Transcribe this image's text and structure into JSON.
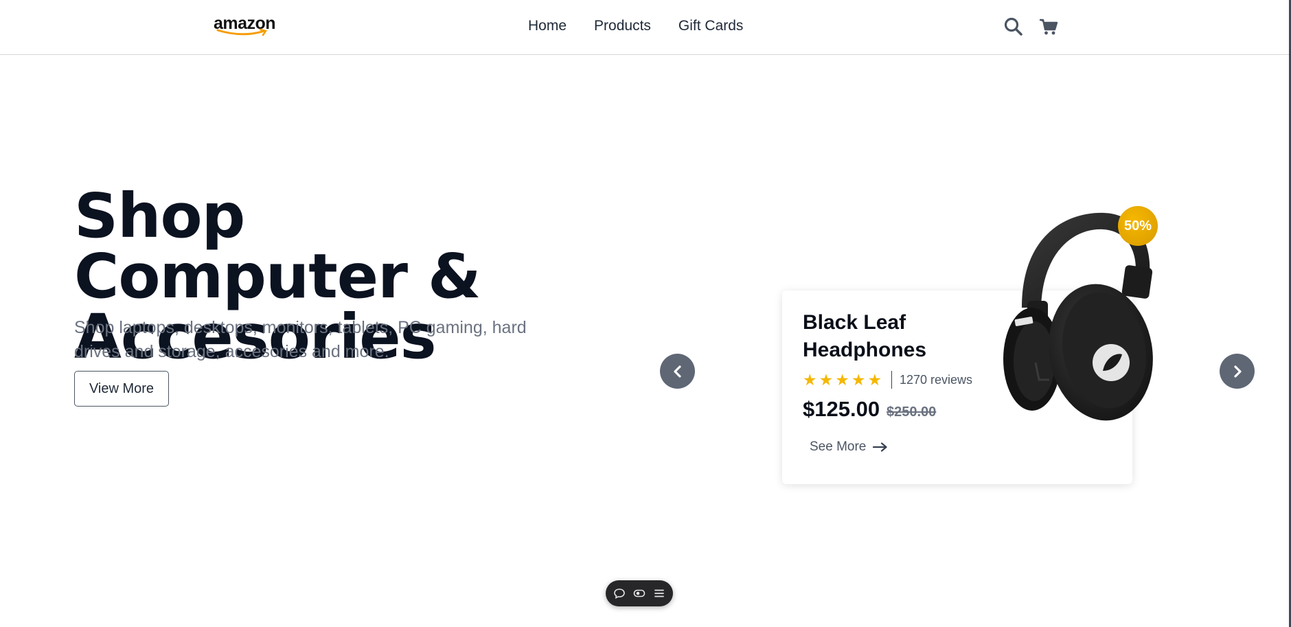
{
  "header": {
    "logo_text": "amazon",
    "nav": [
      "Home",
      "Products",
      "Gift Cards"
    ],
    "icons": [
      "search-icon",
      "cart-icon"
    ]
  },
  "hero": {
    "title": "Shop Computer & Accesories",
    "subtitle": "Shop laptops, desktops, monitors, tablets, PC gaming, hard drives and storage, accesories and more.",
    "button_label": "View More"
  },
  "carousel": {
    "prev_icon": "chevron-left-icon",
    "next_icon": "chevron-right-icon"
  },
  "product": {
    "name": "Black Leaf Headphones",
    "rating": 5,
    "reviews": "1270 reviews",
    "price": "$125.00",
    "old_price": "$250.00",
    "discount": "50%",
    "see_more": "See More",
    "image_icon": "headphones-image"
  },
  "toolbar": {
    "icons": [
      "comment-icon",
      "toggle-icon",
      "menu-icon"
    ]
  },
  "colors": {
    "accent": "#f5b700",
    "arrow_button": "#5f6775",
    "title": "#0b1220",
    "muted": "#6b7280"
  }
}
